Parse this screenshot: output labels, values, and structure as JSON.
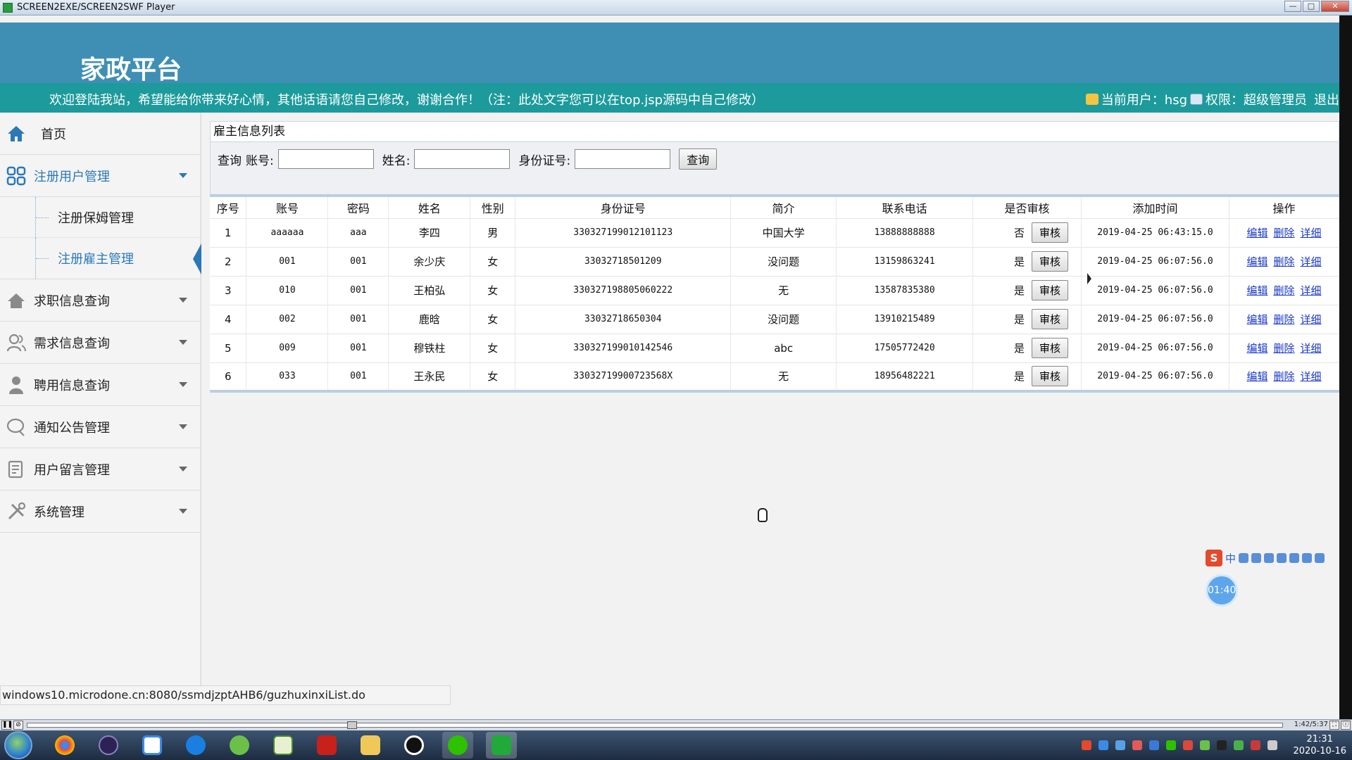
{
  "player": {
    "title": "SCREEN2EXE/SCREEN2SWF Player",
    "time": "1:42/5:37",
    "progress": 0.255,
    "window_buttons": [
      "—",
      "□",
      "✕"
    ]
  },
  "header": {
    "logo": "家政平台",
    "notice": "欢迎登陆我站，希望能给你带来好心情，其他话语请您自己修改，谢谢合作！（注：此处文字您可以在top.jsp源码中自己修改）",
    "user_label": "当前用户：hsg",
    "role_label": "权限：超级管理员",
    "logout_label": "退出"
  },
  "sidebar": {
    "home": "首页",
    "user_mgmt": "注册用户管理",
    "sub_items": [
      "注册保姆管理",
      "注册雇主管理"
    ],
    "items": [
      "求职信息查询",
      "需求信息查询",
      "聘用信息查询",
      "通知公告管理",
      "用户留言管理",
      "系统管理"
    ]
  },
  "main": {
    "panel_title": "雇主信息列表",
    "search": {
      "query_label": "查询",
      "account_label": "账号:",
      "name_label": "姓名:",
      "idcard_label": "身份证号:",
      "search_button": "查询"
    },
    "columns": [
      "序号",
      "账号",
      "密码",
      "姓名",
      "性别",
      "身份证号",
      "简介",
      "联系电话",
      "是否审核",
      "添加时间",
      "操作"
    ],
    "audit_button": "审核",
    "op_edit": "编辑",
    "op_delete": "删除",
    "op_detail": "详细",
    "rows": [
      {
        "no": "1",
        "account": "aaaaaa",
        "password": "aaa",
        "name": "李四",
        "gender": "男",
        "idcard": "330327199012101123",
        "intro": "中国大学",
        "phone": "13888888888",
        "audited": "否",
        "time": "2019-04-25 06:43:15.0"
      },
      {
        "no": "2",
        "account": "001",
        "password": "001",
        "name": "余少庆",
        "gender": "女",
        "idcard": "33032718501209",
        "intro": "没问题",
        "phone": "13159863241",
        "audited": "是",
        "time": "2019-04-25 06:07:56.0"
      },
      {
        "no": "3",
        "account": "010",
        "password": "001",
        "name": "王柏弘",
        "gender": "女",
        "idcard": "330327198805060222",
        "intro": "无",
        "phone": "13587835380",
        "audited": "是",
        "time": "2019-04-25 06:07:56.0"
      },
      {
        "no": "4",
        "account": "002",
        "password": "001",
        "name": "鹿晗",
        "gender": "女",
        "idcard": "33032718650304",
        "intro": "没问题",
        "phone": "13910215489",
        "audited": "是",
        "time": "2019-04-25 06:07:56.0"
      },
      {
        "no": "5",
        "account": "009",
        "password": "001",
        "name": "穆铁柱",
        "gender": "女",
        "idcard": "330327199010142546",
        "intro": "abc",
        "phone": "17505772420",
        "audited": "是",
        "time": "2019-04-25 06:07:56.0"
      },
      {
        "no": "6",
        "account": "033",
        "password": "001",
        "name": "王永民",
        "gender": "女",
        "idcard": "33032719900723568X",
        "intro": "无",
        "phone": "18956482221",
        "audited": "是",
        "time": "2019-04-25 06:07:56.0"
      }
    ]
  },
  "statusbar": {
    "url": "windows10.microdone.cn:8080/ssmdjzptAHB6/guzhuxinxiList.do"
  },
  "ime": {
    "logo": "S",
    "mode": "中",
    "timer": "01:40"
  },
  "taskbar": {
    "clock_time": "21:31",
    "clock_date": "2020-10-16"
  },
  "colors": {
    "header_bg": "#3f8fb5",
    "notice_bg": "#1d9a9b",
    "link": "#1a39c8",
    "active_menu": "#2b78b7"
  }
}
